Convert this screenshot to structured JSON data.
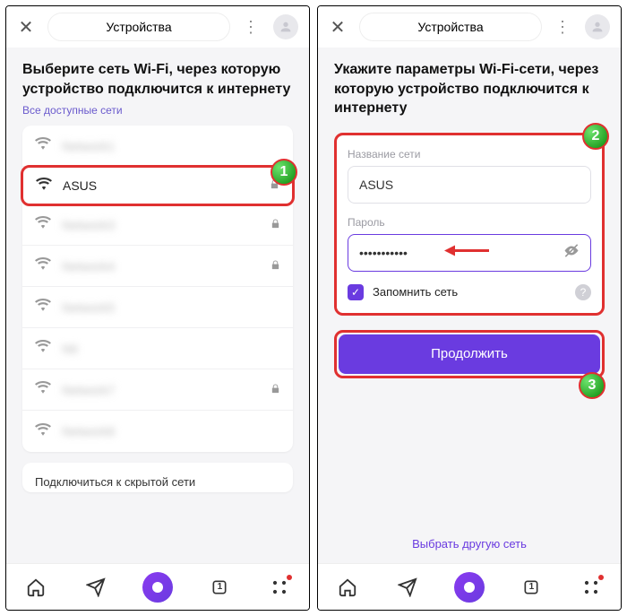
{
  "header": {
    "title": "Устройства"
  },
  "left": {
    "heading": "Выберите сеть Wi-Fi, через которую устройство подключится к интернету",
    "subheading": "Все доступные сети",
    "networks": [
      {
        "name": "Network1",
        "locked": false,
        "blur": true,
        "strong": false
      },
      {
        "name": "ASUS",
        "locked": true,
        "blur": false,
        "strong": true
      },
      {
        "name": "Network3",
        "locked": true,
        "blur": true,
        "strong": false
      },
      {
        "name": "Network4",
        "locked": true,
        "blur": true,
        "strong": false
      },
      {
        "name": "Network5",
        "locked": false,
        "blur": true,
        "strong": false
      },
      {
        "name": "N6",
        "locked": false,
        "blur": true,
        "strong": false
      },
      {
        "name": "Network7",
        "locked": true,
        "blur": true,
        "strong": false
      },
      {
        "name": "Network8",
        "locked": false,
        "blur": true,
        "strong": false
      }
    ],
    "hidden_network": "Подключиться к скрытой сети"
  },
  "right": {
    "heading": "Укажите параметры Wi-Fi-сети, через которую устройство подключится к интернету",
    "name_label": "Название сети",
    "name_value": "ASUS",
    "password_label": "Пароль",
    "password_value": "•••••••••••",
    "remember": "Запомнить сеть",
    "continue": "Продолжить",
    "alt_link": "Выбрать другую сеть"
  },
  "badges": {
    "b1": "1",
    "b2": "2",
    "b3": "3"
  },
  "nav": {
    "tab_count": "1"
  }
}
